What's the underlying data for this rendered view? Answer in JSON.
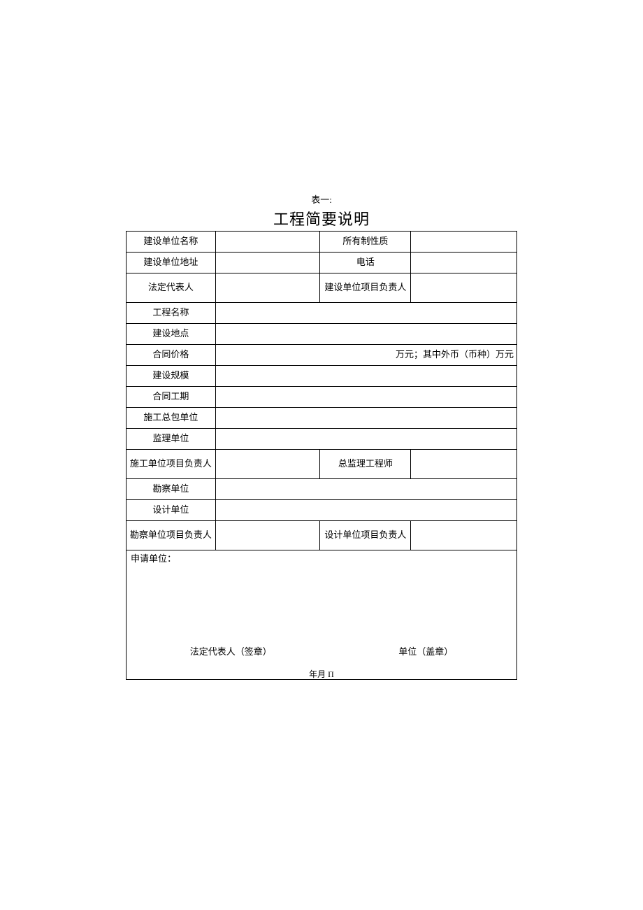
{
  "header": {
    "table_number": "表一:",
    "title": "工程简要说明"
  },
  "rows": {
    "r1": {
      "label1": "建设单位名称",
      "val1": "",
      "label2": "所有制性质",
      "val2": ""
    },
    "r2": {
      "label1": "建设单位地址",
      "val1": "",
      "label2": "电话",
      "val2": ""
    },
    "r3": {
      "label1": "法定代表人",
      "val1": "",
      "label2": "建设单位项目负责人",
      "val2": ""
    },
    "r4": {
      "label1": "工程名称",
      "val1": ""
    },
    "r5": {
      "label1": "建设地点",
      "val1": ""
    },
    "r6": {
      "label1": "合同价格",
      "val1": "万元；其中外币（币种）万元"
    },
    "r7": {
      "label1": "建设规模",
      "val1": ""
    },
    "r8": {
      "label1": "合同工期",
      "val1": ""
    },
    "r9": {
      "label1": "施工总包单位",
      "val1": ""
    },
    "r10": {
      "label1": "监理单位",
      "val1": ""
    },
    "r11": {
      "label1": "施工单位项目负责人",
      "val1": "",
      "label2": "总监理工程师",
      "val2": ""
    },
    "r12": {
      "label1": "勘察单位",
      "val1": ""
    },
    "r13": {
      "label1": "设计单位",
      "val1": ""
    },
    "r14": {
      "label1": "勘察单位项目负责人",
      "val1": "",
      "label2": "设计单位项目负责人",
      "val2": ""
    }
  },
  "footer": {
    "applicant_label": "申请单位：",
    "legal_rep_sign": "法定代表人（签章）",
    "unit_seal": "单位（盖章）",
    "date_label": "年月 Π"
  }
}
